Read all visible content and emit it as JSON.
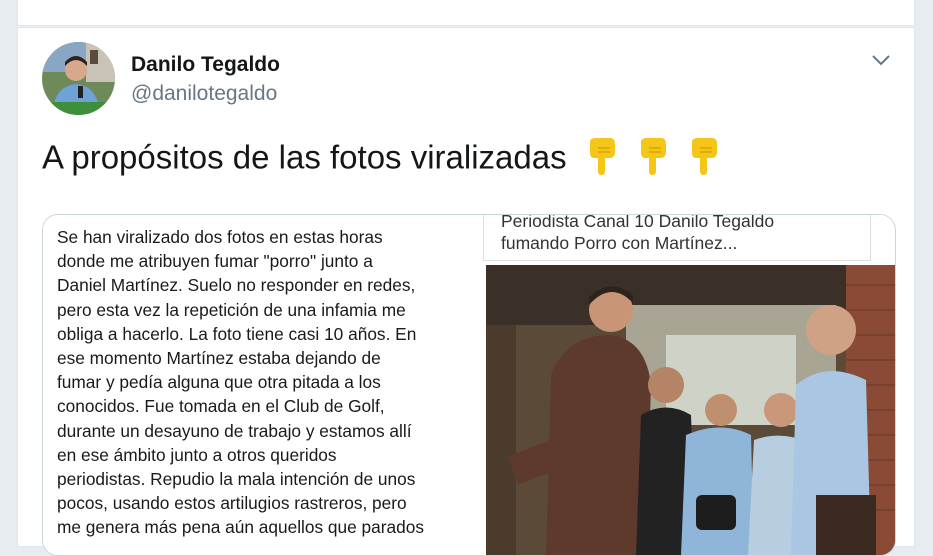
{
  "tweet": {
    "display_name": "Danilo Tegaldo",
    "handle": "@danilotegaldo",
    "text": "A propósitos de las fotos viralizadas",
    "emojis": [
      "backhand-index-pointing-down",
      "backhand-index-pointing-down",
      "backhand-index-pointing-down"
    ],
    "menu_icon": "chevron-down-icon"
  },
  "card": {
    "statement_lines": [
      "Se han viralizado dos fotos en estas horas",
      "donde me atribuyen fumar \"porro\" junto a",
      "Daniel Martínez. Suelo no responder en redes,",
      "pero esta vez la repetición de una infamia me",
      "obliga a hacerlo. La foto tiene casi 10 años. En",
      "ese momento Martínez estaba dejando de",
      "fumar y pedía alguna que otra pitada a los",
      "conocidos. Fue tomada en el Club de Golf,",
      "durante un desayuno de trabajo y estamos allí",
      "en ese ámbito junto a otros queridos",
      "periodistas. Repudio la mala intención de unos",
      "pocos, usando estos artilugios rastreros, pero",
      "me genera más pena aún aquellos que parados"
    ],
    "headline_lines": [
      "Periodista Canal 10 Danilo Tegaldo",
      "fumando Porro con Martínez..."
    ]
  },
  "colors": {
    "background": "#e6ecf0",
    "name": "#14171a",
    "handle": "#657786",
    "emoji": "#f5c518"
  }
}
